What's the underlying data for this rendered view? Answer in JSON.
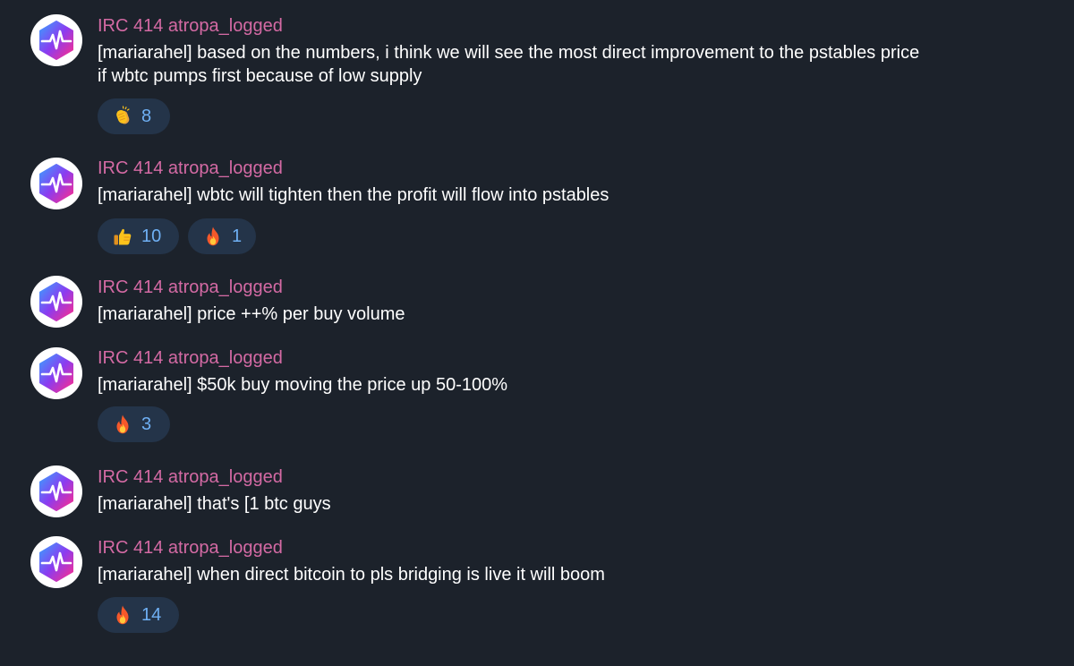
{
  "colors": {
    "background": "#1c222b",
    "sender_name": "#d46aa4",
    "message_text": "#ffffff",
    "reaction_bg": "#243449",
    "reaction_count": "#6fb0f4"
  },
  "messages": [
    {
      "sender": "IRC 414 atropa_logged",
      "avatar_icon": "heartbeat-hexagon-icon",
      "text_line1": "[mariarahel] based on the numbers, i think we will see the most direct improvement to the pstables price",
      "text_line2": "if wbtc pumps first because of low supply",
      "reactions": [
        {
          "emoji": "clapping-hands-icon",
          "count": "8"
        }
      ]
    },
    {
      "sender": "IRC 414 atropa_logged",
      "avatar_icon": "heartbeat-hexagon-icon",
      "text": "[mariarahel] wbtc will tighten then the profit will flow into pstables",
      "reactions": [
        {
          "emoji": "thumbs-up-icon",
          "count": "10"
        },
        {
          "emoji": "fire-icon",
          "count": "1"
        }
      ]
    },
    {
      "sender": "IRC 414 atropa_logged",
      "avatar_icon": "heartbeat-hexagon-icon",
      "text": "[mariarahel] price ++% per buy volume",
      "reactions": []
    },
    {
      "sender": "IRC 414 atropa_logged",
      "avatar_icon": "heartbeat-hexagon-icon",
      "text": "[mariarahel] $50k buy moving the price up 50-100%",
      "reactions": [
        {
          "emoji": "fire-icon",
          "count": "3"
        }
      ]
    },
    {
      "sender": "IRC 414 atropa_logged",
      "avatar_icon": "heartbeat-hexagon-icon",
      "text": "[mariarahel] that's [1 btc guys",
      "reactions": []
    },
    {
      "sender": "IRC 414 atropa_logged",
      "avatar_icon": "heartbeat-hexagon-icon",
      "text": "[mariarahel] when direct bitcoin to pls bridging is live it will boom",
      "reactions": [
        {
          "emoji": "fire-icon",
          "count": "14"
        }
      ]
    }
  ]
}
